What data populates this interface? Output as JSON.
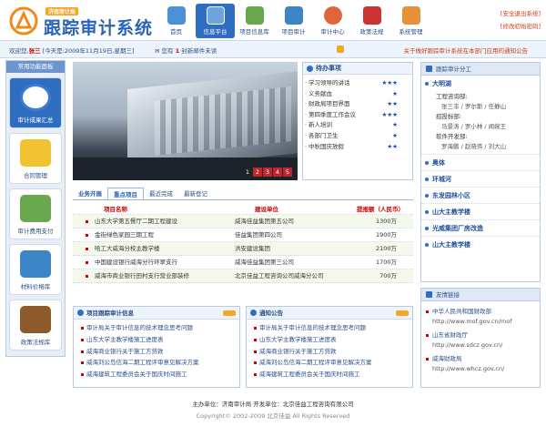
{
  "header": {
    "logo_tag": "济南审计局",
    "title": "跟踪审计系统",
    "nav": [
      {
        "label": "首页",
        "icon": "home-icon",
        "color": "#4a90d9"
      },
      {
        "label": "信息平台",
        "icon": "info-platform-icon",
        "color": "#ffffff"
      },
      {
        "label": "项目信息库",
        "icon": "project-library-icon",
        "color": "#6aa84f"
      },
      {
        "label": "项目审计",
        "icon": "project-audit-icon",
        "color": "#3d85c6"
      },
      {
        "label": "审计中心",
        "icon": "audit-center-icon",
        "color": "#e0663a"
      },
      {
        "label": "政策法规",
        "icon": "policy-icon",
        "color": "#cc3333"
      },
      {
        "label": "系统管理",
        "icon": "system-settings-icon",
        "color": "#e69138"
      }
    ],
    "active_index": 1,
    "top_links": [
      "[安全退出系统]",
      "[修改初始密码]"
    ]
  },
  "status": {
    "welcome_prefix": "欢迎您,",
    "user": "张三",
    "date_text": "[今天是:2009年11月19日,星期三]",
    "mail_prefix": "您有",
    "mail_count": "1",
    "mail_suffix": "封新邮件未读",
    "notice": "关于做好跟踪审计系统在本部门应用的通知公告"
  },
  "sidebar": {
    "title": "常用功能面板",
    "items": [
      {
        "label": "审计成果汇总",
        "icon": "audit-results-icon",
        "color": "#3a7bd5"
      },
      {
        "label": "合同管理",
        "icon": "contract-folder-icon",
        "color": "#f1c232"
      },
      {
        "label": "审计费用支付",
        "icon": "payment-icon",
        "color": "#6aa84f"
      },
      {
        "label": "材料价格库",
        "icon": "material-price-icon",
        "color": "#3d85c6"
      },
      {
        "label": "政策法规库",
        "icon": "policy-library-icon",
        "color": "#8e5a2b"
      }
    ]
  },
  "banner": {
    "pages": [
      "1",
      "2",
      "3",
      "4",
      "5"
    ],
    "active_page": 0
  },
  "todo": {
    "title": "待办事项",
    "items": [
      {
        "label": "学习领导的讲话",
        "stars": "★★★"
      },
      {
        "label": "义务献血",
        "stars": "★"
      },
      {
        "label": "财政局项目界面",
        "stars": "★★"
      },
      {
        "label": "第四季度工作会议",
        "stars": "★★★"
      },
      {
        "label": "新人培训",
        "stars": "★"
      },
      {
        "label": "各部门卫生",
        "stars": "★"
      },
      {
        "label": "中秋国庆放假",
        "stars": "★★"
      }
    ]
  },
  "tabs": {
    "items": [
      "业务开展",
      "重点项目",
      "最近完成",
      "最新登记"
    ],
    "active": 1
  },
  "table": {
    "headers": [
      "项目名称",
      "建设单位",
      "提报额（人民币）"
    ],
    "rows": [
      [
        "山东大学第五餐厅二期工程建设",
        "威海佳益集团第五公司",
        "1300万"
      ],
      [
        "金街绿色家园三期工程",
        "佳益集团第四公司",
        "1900万"
      ],
      [
        "哈工大威海分校主教学楼",
        "洪安建设集团",
        "2100万"
      ],
      [
        "中国建设银行威海分行环翠支行",
        "威海佳益集团第三公司",
        "1700万"
      ],
      [
        "威海市商业银行田村支行营业部装修",
        "北京佳益工程咨询公司威海分公司",
        "700万"
      ]
    ]
  },
  "panel_left": {
    "title": "项目跟踪审计信息",
    "items": [
      "审计局关于审计信息的技术理念思考问题",
      "山东大学主教学楼施工进度表",
      "威海商业银行关于施工方贷款",
      "威海刘公岛信海二期工程评审意见解决方案",
      "威海建筑工程委员会关于国庆时间施工"
    ]
  },
  "panel_right": {
    "title": "通知公告",
    "items": [
      "审计局关于审计信息的技术理念思考问题",
      "山东大学主教学楼施工进度表",
      "威海商业银行关于施工方贷款",
      "威海刘公岛信海二期工程评审意见解决方案",
      "威海建筑工程委员会关于国庆时间施工"
    ]
  },
  "division": {
    "title": "跟踪审计分工",
    "group1": {
      "name": "大明湖",
      "sections": [
        {
          "label": "工程咨询部:",
          "members": "张三丰 / 罗尔斯 / 任静山"
        },
        {
          "label": "招投标部:",
          "members": "马景涛 / 罗小林 / 闻婉王"
        },
        {
          "label": "软件开发部:",
          "members": "罗海鹏 / 赵晓伟 / 刘大山"
        }
      ]
    },
    "groups": [
      "奥体",
      "环城河",
      "东发园林小区",
      "山大主教学楼",
      "光威集团厂房改造",
      "山大主教学楼"
    ]
  },
  "links": {
    "title": "友情链接",
    "items": [
      {
        "name": "中华人民共和国财政部",
        "url": "http://www.mof.gov.cn/mof"
      },
      {
        "name": "山东省财政厅",
        "url": "http://www.sdcz.gov.cn/"
      },
      {
        "name": "威海财政局",
        "url": "http://www.whcz.gov.cn/"
      }
    ]
  },
  "footer": {
    "line1": "主办单位：济南审计局     开发单位：北京佳益工程咨询有限公司",
    "line2": "Copyright© 2002-2009 北京佳益 All Rights Reserved"
  }
}
